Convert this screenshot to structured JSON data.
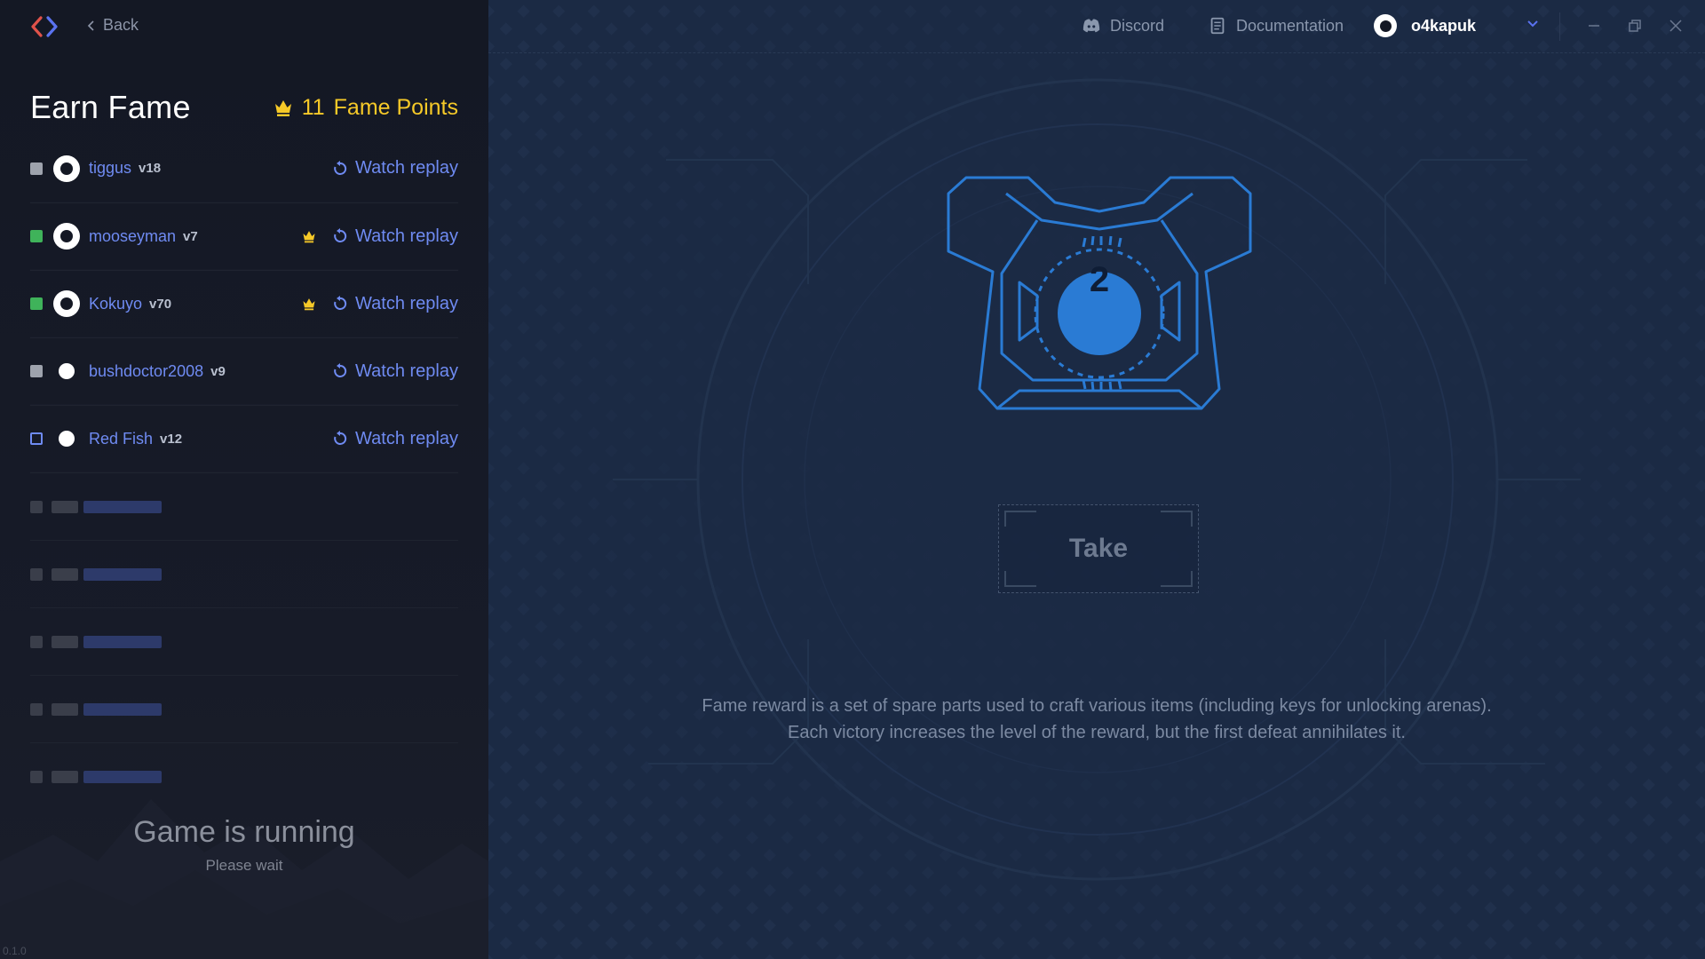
{
  "nav": {
    "back_label": "Back"
  },
  "sidebar": {
    "title": "Earn Fame",
    "fame_points": {
      "value": "11",
      "label": "Fame Points"
    },
    "players": [
      {
        "name": "tiggus",
        "version": "v18",
        "status_color": "#9ea3ad",
        "avatar": "ring",
        "crown": false,
        "action": "Watch replay"
      },
      {
        "name": "mooseyman",
        "version": "v7",
        "status_color": "#3fb35a",
        "avatar": "ring",
        "crown": true,
        "action": "Watch replay"
      },
      {
        "name": "Kokuyo",
        "version": "v70",
        "status_color": "#3fb35a",
        "avatar": "ring",
        "crown": true,
        "action": "Watch replay"
      },
      {
        "name": "bushdoctor2008",
        "version": "v9",
        "status_color": "#9ea3ad",
        "avatar": "dot",
        "crown": false,
        "action": "Watch replay"
      },
      {
        "name": "Red Fish",
        "version": "v12",
        "status_color": "outline-blue",
        "avatar": "dot",
        "crown": false,
        "action": "Watch replay"
      }
    ],
    "game_status": {
      "title": "Game is running",
      "subtitle": "Please wait"
    },
    "version": "0.1.0"
  },
  "topbar": {
    "discord_label": "Discord",
    "docs_label": "Documentation",
    "username": "o4kapuk"
  },
  "main": {
    "reward_level": "2",
    "take_label": "Take",
    "description_line1": "Fame reward is a set of spare parts used to craft various items (including keys for unlocking arenas).",
    "description_line2": "Each victory increases the level of the reward, but the first defeat annihilates it."
  },
  "colors": {
    "accent": "#6f8bf2",
    "gold": "#f6c928",
    "reward_blue": "#2a7bd4",
    "status_green": "#3fb35a"
  },
  "icons": {
    "logo": "code-brackets-logo",
    "fame": "crown-icon",
    "replay": "replay-icon",
    "discord": "discord-icon",
    "docs": "document-icon"
  }
}
